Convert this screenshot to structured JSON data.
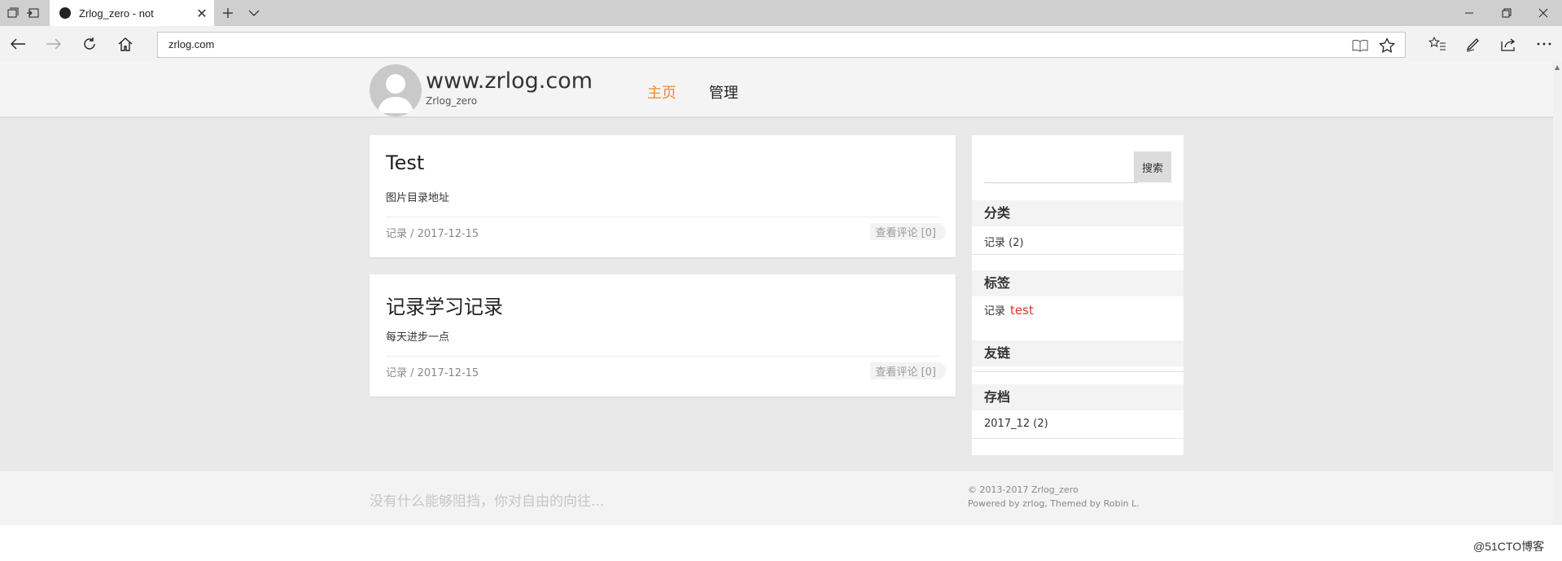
{
  "browser": {
    "tab": {
      "title": "Zrlog_zero - not",
      "close_icon": "close-icon"
    },
    "address_value": "zrlog.com",
    "icons": [
      "tab-set-aside-icon",
      "tab-preview-icon",
      "new-tab-icon",
      "tab-list-icon",
      "minimize-icon",
      "restore-icon",
      "close-icon",
      "back-icon",
      "forward-icon",
      "refresh-icon",
      "home-icon",
      "reading-view-icon",
      "favorite-star-icon",
      "favorites-hub-icon",
      "web-note-icon",
      "share-icon",
      "more-icon"
    ]
  },
  "site": {
    "title": "www.zrlog.com",
    "subtitle": "Zrlog_zero",
    "nav": [
      {
        "label": "主页",
        "active": true,
        "color": "#f08c2e"
      },
      {
        "label": "管理",
        "active": false
      }
    ]
  },
  "posts": [
    {
      "title": "Test",
      "excerpt": "图片目录地址",
      "meta": "记录 / 2017-12-15",
      "comments": "查看评论 [0]"
    },
    {
      "title": "记录学习记录",
      "excerpt": "每天进步一点",
      "meta": "记录 / 2017-12-15",
      "comments": "查看评论 [0]"
    }
  ],
  "sidebar": {
    "search_button": "搜索",
    "search_value": "",
    "categories": {
      "heading": "分类",
      "items": [
        "记录 (2)"
      ]
    },
    "tags": {
      "heading": "标签",
      "items": [
        "记录",
        "test"
      ],
      "accent": "#d9352b"
    },
    "links": {
      "heading": "友链",
      "items": []
    },
    "archives": {
      "heading": "存档",
      "items": [
        "2017_12 (2)"
      ]
    }
  },
  "footer": {
    "quote": "没有什么能够阻挡，你对自由的向往...",
    "copyright": "© 2013-2017 Zrlog_zero",
    "powered": "Powered by zrlog, Themed by Robin L."
  },
  "watermark": "@51CTO博客"
}
